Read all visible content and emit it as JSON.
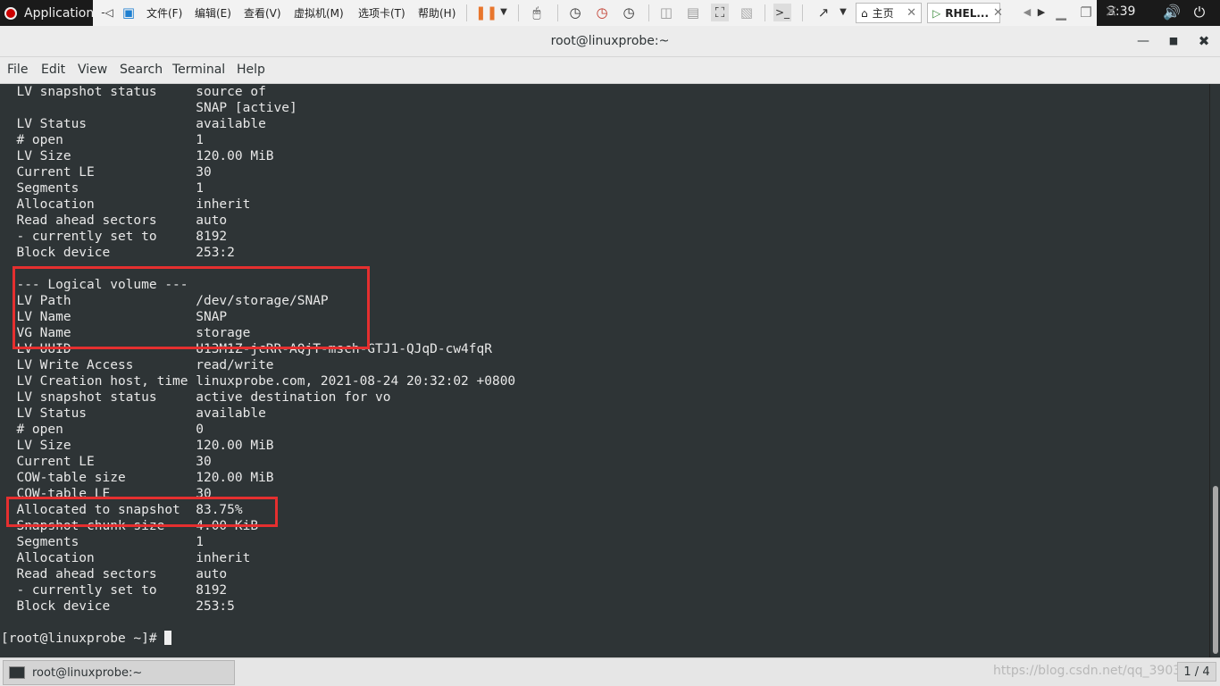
{
  "gnome_bar": {
    "applications_label": "Application",
    "clock": "3:39"
  },
  "vm_toolbar": {
    "menus": [
      "文件(F)",
      "编辑(E)",
      "查看(V)",
      "虚拟机(M)",
      "选项卡(T)",
      "帮助(H)"
    ],
    "tabs": [
      {
        "label": "主页",
        "icon": "home-icon"
      },
      {
        "label": "RHEL...",
        "icon": "vm-icon"
      }
    ]
  },
  "window": {
    "title": "root@linuxprobe:~"
  },
  "menu_bar": {
    "items": [
      "File",
      "Edit",
      "View",
      "Search",
      "Terminal",
      "Help"
    ]
  },
  "terminal": {
    "lines": [
      "  LV snapshot status     source of",
      "                         SNAP [active]",
      "  LV Status              available",
      "  # open                 1",
      "  LV Size                120.00 MiB",
      "  Current LE             30",
      "  Segments               1",
      "  Allocation             inherit",
      "  Read ahead sectors     auto",
      "  - currently set to     8192",
      "  Block device           253:2",
      "",
      "  --- Logical volume ---",
      "  LV Path                /dev/storage/SNAP",
      "  LV Name                SNAP",
      "  VG Name                storage",
      "  LV UUID                U13M1Z-jcRR-AQjT-msch-GTJ1-QJqD-cw4fqR",
      "  LV Write Access        read/write",
      "  LV Creation host, time linuxprobe.com, 2021-08-24 20:32:02 +0800",
      "  LV snapshot status     active destination for vo",
      "  LV Status              available",
      "  # open                 0",
      "  LV Size                120.00 MiB",
      "  Current LE             30",
      "  COW-table size         120.00 MiB",
      "  COW-table LE           30",
      "  Allocated to snapshot  83.75%",
      "  Snapshot chunk size    4.00 KiB",
      "  Segments               1",
      "  Allocation             inherit",
      "  Read ahead sectors     auto",
      "  - currently set to     8192",
      "  Block device           253:5",
      ""
    ],
    "prompt": "[root@linuxprobe ~]# "
  },
  "taskbar": {
    "window_label": "root@linuxprobe:~",
    "watermark": "https://blog.csdn.net/qq_3903",
    "workspace": "1 / 4"
  },
  "colors": {
    "terminal_bg": "#2e3436",
    "terminal_fg": "#e8e8e8",
    "highlight_box": "#e52f2f"
  }
}
